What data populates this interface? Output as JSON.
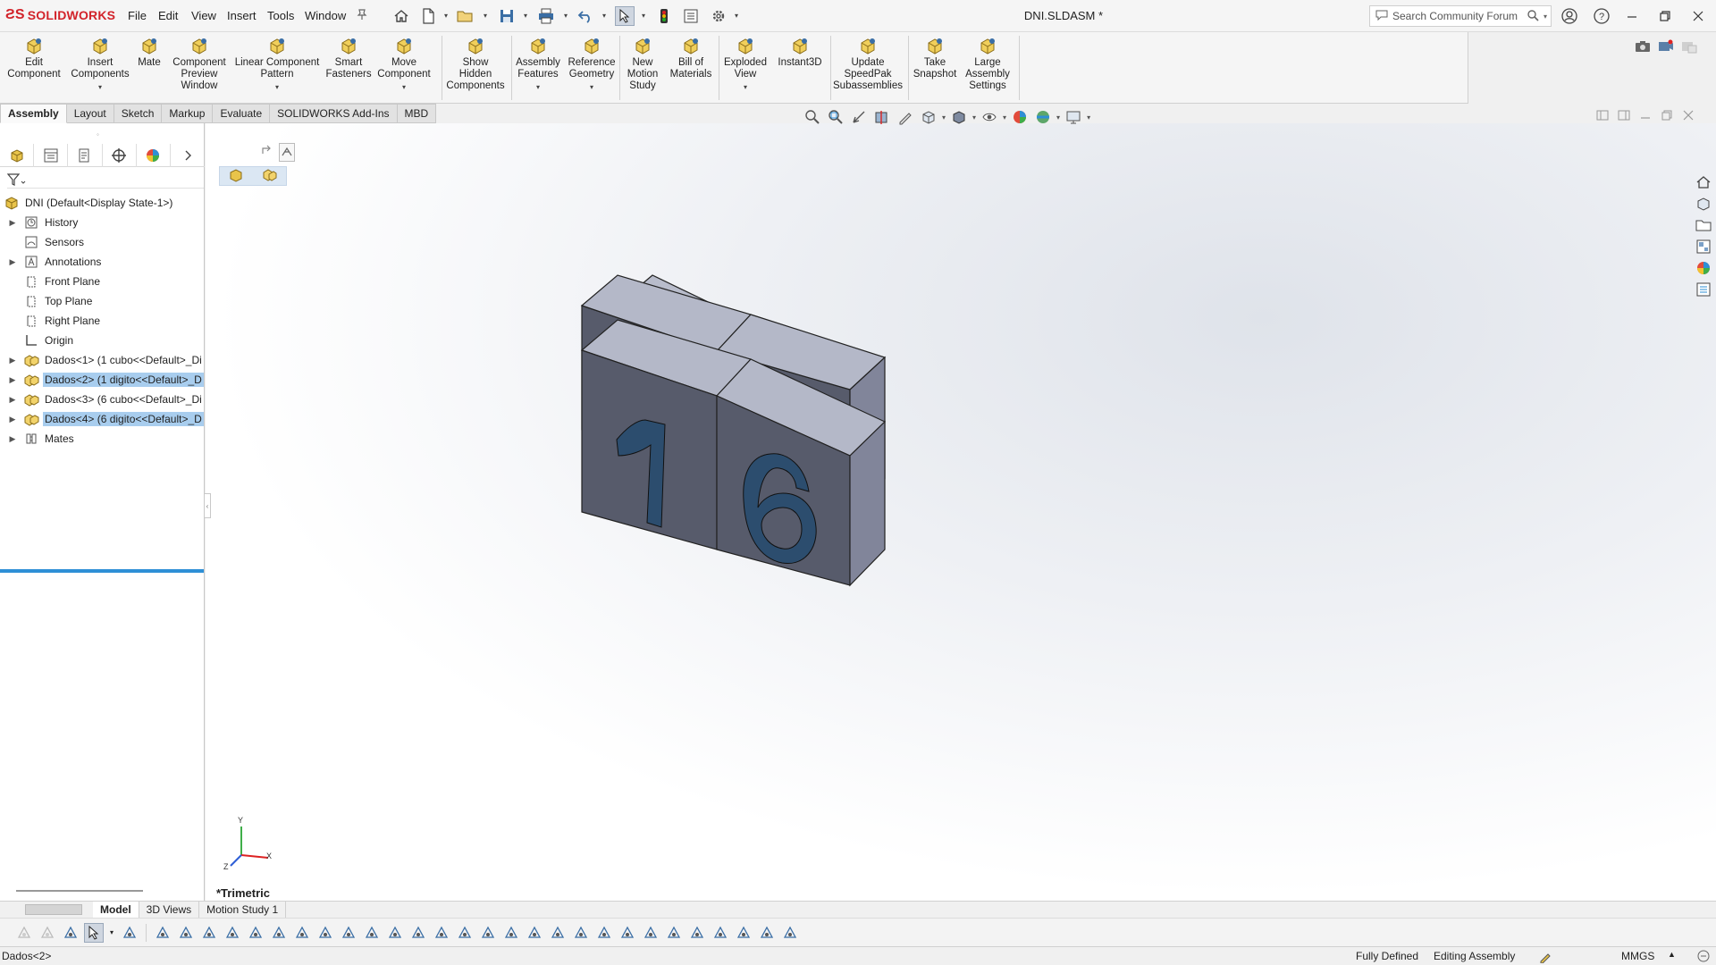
{
  "app": {
    "logo_ds": "ƧS",
    "logo_text": "SOLIDWORKS",
    "document_title": "DNI.SLDASM *"
  },
  "menu": [
    "File",
    "Edit",
    "View",
    "Insert",
    "Tools",
    "Window"
  ],
  "search": {
    "placeholder": "Search Community Forum"
  },
  "ribbon": {
    "buttons": [
      {
        "label": "Edit\nComponent",
        "icon": "edit-component-icon"
      },
      {
        "label": "Insert\nComponents",
        "icon": "insert-components-icon",
        "dropdown": true
      },
      {
        "label": "Mate",
        "icon": "mate-icon"
      },
      {
        "label": "Component\nPreview\nWindow",
        "icon": "component-preview-icon"
      },
      {
        "label": "Linear Component\nPattern",
        "icon": "linear-pattern-icon",
        "dropdown": true
      },
      {
        "label": "Smart\nFasteners",
        "icon": "smart-fasteners-icon"
      },
      {
        "label": "Move\nComponent",
        "icon": "move-component-icon",
        "dropdown": true
      },
      {
        "label": "Show\nHidden\nComponents",
        "icon": "show-hidden-icon"
      },
      {
        "label": "Assembly\nFeatures",
        "icon": "assembly-features-icon",
        "dropdown": true
      },
      {
        "label": "Reference\nGeometry",
        "icon": "reference-geometry-icon",
        "dropdown": true
      },
      {
        "label": "New\nMotion\nStudy",
        "icon": "motion-study-icon"
      },
      {
        "label": "Bill of\nMaterials",
        "icon": "bill-of-materials-icon"
      },
      {
        "label": "Exploded\nView",
        "icon": "exploded-view-icon",
        "dropdown": true
      },
      {
        "label": "Instant3D",
        "icon": "instant3d-icon"
      },
      {
        "label": "Update\nSpeedPak\nSubassemblies",
        "icon": "speedpak-icon"
      },
      {
        "label": "Take\nSnapshot",
        "icon": "snapshot-icon"
      },
      {
        "label": "Large\nAssembly\nSettings",
        "icon": "large-assembly-icon"
      }
    ]
  },
  "tabs": [
    "Assembly",
    "Layout",
    "Sketch",
    "Markup",
    "Evaluate",
    "SOLIDWORKS Add-Ins",
    "MBD"
  ],
  "active_tab": "Assembly",
  "tree": {
    "root": "DNI  (Default<Display State-1>)",
    "items": [
      {
        "label": "History",
        "icon": "history-folder-icon",
        "expandable": true,
        "selected": false
      },
      {
        "label": "Sensors",
        "icon": "sensors-folder-icon",
        "expandable": false,
        "selected": false
      },
      {
        "label": "Annotations",
        "icon": "annotations-folder-icon",
        "expandable": true,
        "selected": false
      },
      {
        "label": "Front Plane",
        "icon": "plane-icon",
        "expandable": false,
        "selected": false
      },
      {
        "label": "Top Plane",
        "icon": "plane-icon",
        "expandable": false,
        "selected": false
      },
      {
        "label": "Right Plane",
        "icon": "plane-icon",
        "expandable": false,
        "selected": false
      },
      {
        "label": "Origin",
        "icon": "origin-icon",
        "expandable": false,
        "selected": false
      },
      {
        "label": "Dados<1> (1 cubo<<Default>_Di",
        "icon": "part-icon",
        "expandable": true,
        "selected": false
      },
      {
        "label": "Dados<2> (1 digito<<Default>_D",
        "icon": "part-icon",
        "expandable": true,
        "selected": true
      },
      {
        "label": "Dados<3> (6 cubo<<Default>_Di",
        "icon": "part-icon",
        "expandable": true,
        "selected": false
      },
      {
        "label": "Dados<4> (6 digito<<Default>_D",
        "icon": "part-icon",
        "expandable": true,
        "selected": true
      },
      {
        "label": "Mates",
        "icon": "mates-folder-icon",
        "expandable": true,
        "selected": false
      }
    ]
  },
  "viewport": {
    "view_orientation": "*Trimetric",
    "triad_axes": [
      "Y",
      "X",
      "Z"
    ],
    "model_digits": [
      "1",
      "6"
    ]
  },
  "model_tabs": [
    "Model",
    "3D Views",
    "Motion Study 1"
  ],
  "active_model_tab": "Model",
  "status": {
    "selection": "Dados<2>",
    "definition": "Fully Defined",
    "mode": "Editing Assembly",
    "units": "MMGS"
  },
  "colors": {
    "brand_red": "#d2232a",
    "selection_blue": "#a8cdee",
    "rollback_bar": "#2e8fd6",
    "cube_top": "#b8bccb",
    "cube_front": "#575b6b",
    "cube_side": "#81859a",
    "digit_fill": "#2c4d6e"
  }
}
